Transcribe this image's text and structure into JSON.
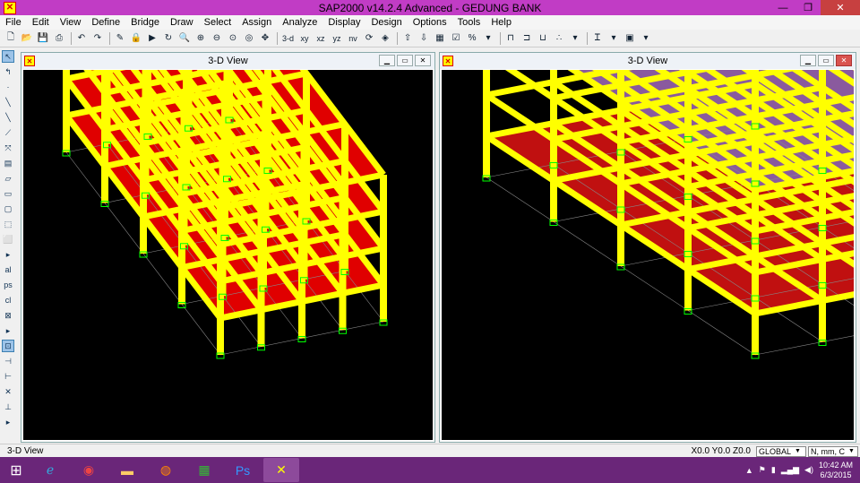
{
  "window": {
    "title": "SAP2000 v14.2.4 Advanced  - GEDUNG BANK",
    "app_icon": "sap-logo-icon"
  },
  "menu": [
    "File",
    "Edit",
    "View",
    "Define",
    "Bridge",
    "Draw",
    "Select",
    "Assign",
    "Analyze",
    "Display",
    "Design",
    "Options",
    "Tools",
    "Help"
  ],
  "toolbar": {
    "view_labels": [
      "3-d",
      "xy",
      "xz",
      "yz",
      "nv"
    ]
  },
  "views": [
    {
      "title": "3-D View"
    },
    {
      "title": "3-D View"
    }
  ],
  "status": {
    "left": "3-D View",
    "coords": "X0.0  Y0.0  Z0.0",
    "coord_system": "GLOBAL",
    "units": "N, mm, C"
  },
  "taskbar": {
    "time": "10:42 AM",
    "date": "6/3/2015"
  },
  "colors": {
    "frame": "#ffff00",
    "slab": "#e00000",
    "background": "#000000",
    "supports": "#00ff00"
  }
}
